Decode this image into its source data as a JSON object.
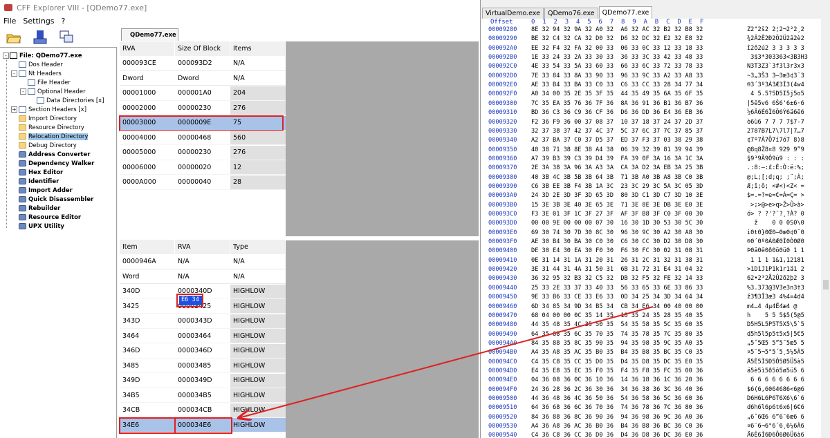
{
  "cff": {
    "title": "CFF Explorer VIII - [QDemo77.exe]",
    "menu": [
      "File",
      "Settings",
      "?"
    ],
    "active_tab": "QDemo77.exe",
    "tree": [
      {
        "label": "File: QDemo77.exe",
        "level": 0,
        "icon": "pe",
        "bold": true
      },
      {
        "label": "Dos Header",
        "level": 1,
        "icon": "doc"
      },
      {
        "label": "Nt Headers",
        "level": 1,
        "icon": "doc"
      },
      {
        "label": "File Header",
        "level": 2,
        "icon": "doc"
      },
      {
        "label": "Optional Header",
        "level": 2,
        "icon": "doc"
      },
      {
        "label": "Data Directories [x]",
        "level": 3,
        "icon": "doc"
      },
      {
        "label": "Section Headers [x]",
        "level": 1,
        "icon": "doc"
      },
      {
        "label": "Import Directory",
        "level": 1,
        "icon": "folder"
      },
      {
        "label": "Resource Directory",
        "level": 1,
        "icon": "folder"
      },
      {
        "label": "Relocation Directory",
        "level": 1,
        "icon": "folder",
        "selected": true
      },
      {
        "label": "Debug Directory",
        "level": 1,
        "icon": "folder"
      },
      {
        "label": "Address Converter",
        "level": 1,
        "icon": "tool",
        "bold": true
      },
      {
        "label": "Dependency Walker",
        "level": 1,
        "icon": "tool",
        "bold": true
      },
      {
        "label": "Hex Editor",
        "level": 1,
        "icon": "tool",
        "bold": true
      },
      {
        "label": "Identifier",
        "level": 1,
        "icon": "tool",
        "bold": true
      },
      {
        "label": "Import Adder",
        "level": 1,
        "icon": "tool",
        "bold": true
      },
      {
        "label": "Quick Disassembler",
        "level": 1,
        "icon": "tool",
        "bold": true
      },
      {
        "label": "Rebuilder",
        "level": 1,
        "icon": "tool",
        "bold": true
      },
      {
        "label": "Resource Editor",
        "level": 1,
        "icon": "tool",
        "bold": true
      },
      {
        "label": "UPX Utility",
        "level": 1,
        "icon": "tool",
        "bold": true
      }
    ],
    "top_table": {
      "headers": [
        "RVA",
        "Size Of Block",
        "Items"
      ],
      "first_row": [
        "000093CE",
        "000093D2",
        "N/A"
      ],
      "subheaders": [
        "Dword",
        "Dword",
        "N/A"
      ],
      "rows": [
        [
          "00001000",
          "000001A0",
          "204"
        ],
        [
          "00002000",
          "00000230",
          "276"
        ],
        [
          "00003000",
          "0000009E",
          "75"
        ],
        [
          "00004000",
          "00000468",
          "560"
        ],
        [
          "00005000",
          "00000230",
          "276"
        ],
        [
          "00006000",
          "00000020",
          "12"
        ],
        [
          "0000A000",
          "00000040",
          "28"
        ]
      ],
      "selected_row": 2
    },
    "bottom_table": {
      "headers": [
        "Item",
        "RVA",
        "Type"
      ],
      "first_row": [
        "0000946A",
        "N/A",
        "N/A"
      ],
      "subheaders": [
        "Word",
        "N/A",
        "N/A"
      ],
      "rows": [
        [
          "340D",
          "0000340D",
          "HIGHLOW"
        ],
        [
          "3425",
          "00003425",
          "HIGHLOW"
        ],
        [
          "343D",
          "0000343D",
          "HIGHLOW"
        ],
        [
          "3464",
          "00003464",
          "HIGHLOW"
        ],
        [
          "346D",
          "0000346D",
          "HIGHLOW"
        ],
        [
          "3485",
          "00003485",
          "HIGHLOW"
        ],
        [
          "349D",
          "0000349D",
          "HIGHLOW"
        ],
        [
          "34B5",
          "000034B5",
          "HIGHLOW"
        ],
        [
          "34CB",
          "000034CB",
          "HIGHLOW"
        ],
        [
          "34E6",
          "000034E6",
          "HIGHLOW"
        ]
      ],
      "selected_row": 9
    }
  },
  "hex": {
    "tabs": [
      "VirtualDemo.exe",
      "QDemo76.exe",
      "QDemo77.exe"
    ],
    "active_tab": 2,
    "header_offset": "Offset",
    "header_cols": "0  1  2  3  4  5  6  7  8  9  A  B  C  D  E  F",
    "selected_bytes": "E6 34",
    "rows": [
      {
        "o": "00009280",
        "b": "8E 32 94 32 9A 32 A0 32  A6 32 AC 32 B2 32 B8 32",
        "a": "Ž2\"2š2 2¦2¬2²2¸2"
      },
      {
        "o": "00009290",
        "b": "BE 32 C4 32 CA 32 D0 32  D6 32 DC 32 E2 32 E8 32",
        "a": "¾2Ä2Ê2Ð2Ö2Ü2â2è2"
      },
      {
        "o": "000092A0",
        "b": "EE 32 F4 32 FA 32 00 33  06 33 0C 33 12 33 18 33",
        "a": "î2ô2ú2 3 3 3 3 3"
      },
      {
        "o": "000092B0",
        "b": "1E 33 24 33 2A 33 30 33  36 33 3C 33 42 33 48 33",
        "a": " 3$3*303363<3B3H3"
      },
      {
        "o": "000092C0",
        "b": "4E 33 54 33 5A 33 60 33  66 33 6C 33 72 33 78 33",
        "a": "N3T3Z3`3f3l3r3x3"
      },
      {
        "o": "000092D0",
        "b": "7E 33 84 33 8A 33 90 33  96 33 9C 33 A2 33 A8 33",
        "a": "~3„3Š3 3–3œ3¢3¨3"
      },
      {
        "o": "000092E0",
        "b": "AE 33 B4 33 BA 33 C0 33  C6 33 CC 33 28 34 77 34",
        "a": "®3´3º3À3Æ3Ì3(4w4"
      },
      {
        "o": "000092F0",
        "b": "A0 34 00 35 2E 35 3F 35  44 35 49 35 6A 35 6F 35",
        "a": " 4 5.5?5D5I5j5o5"
      },
      {
        "o": "00009300",
        "b": "7C 35 EA 35 76 36 7F 36  8A 36 91 36 B1 36 B7 36",
        "a": "|5ê5v6 6Š6'6±6·6"
      },
      {
        "o": "00009310",
        "b": "BD 36 C3 36 C9 36 CF 36  D6 36 DD 36 E4 36 EB 36",
        "a": "½6Ã6É6Ï6Ö6Ý6ä6ë6"
      },
      {
        "o": "00009320",
        "b": "F2 36 F9 36 00 37 08 37  10 37 18 37 24 37 2D 37",
        "a": "ò6ù6 7 7 7 7$7-7"
      },
      {
        "o": "00009330",
        "b": "32 37 38 37 42 37 4C 37  5C 37 6C 37 7C 37 85 37",
        "a": "2787B7L7\\7l7|7…7"
      },
      {
        "o": "00009340",
        "b": "A2 37 BA 37 C0 37 D5 37  ED 37 F3 37 03 38 29 38",
        "a": "¢7º7À7Õ7í7ó7 8)8"
      },
      {
        "o": "00009350",
        "b": "40 38 71 38 8E 38 A4 38  06 39 32 39 81 39 94 39",
        "a": "@8q8Ž8¤8 929 9”9"
      },
      {
        "o": "00009360",
        "b": "A7 39 B3 39 C3 39 D4 39  FA 39 0F 3A 16 3A 1C 3A",
        "a": "§9³9Ã9Ô9ú9 : : :"
      },
      {
        "o": "00009370",
        "b": "2E 3A 38 3A 96 3A A3 3A  CA 3A D2 3A EB 3A 25 3B",
        "a": ".:8:–:£:Ê:Ò:ë:%;"
      },
      {
        "o": "00009380",
        "b": "40 3B 4C 3B 5B 3B 64 3B  71 3B A0 3B A8 3B C0 3B",
        "a": "@;L;[;d;q; ;¨;À;"
      },
      {
        "o": "00009390",
        "b": "C6 3B EE 3B F4 3B 1A 3C  23 3C 29 3C 5A 3C 05 3D",
        "a": "Æ;î;ô; <#<)<Z< ="
      },
      {
        "o": "000093A0",
        "b": "24 3D 2E 3D 3F 3D 65 3D  80 3D C1 3D C7 3D 10 3E",
        "a": "$=.=?=e=€=Á=Ç= >"
      },
      {
        "o": "000093B0",
        "b": "15 3E 3B 3E 40 3E 65 3E  71 3E 8E 3E DB 3E E0 3E",
        "a": " >;>@>e>q>Ž>Û>à>"
      },
      {
        "o": "000093C0",
        "b": "F3 3E 01 3F 1C 3F 27 3F  AF 3F B8 3F C0 3F 00 30",
        "a": "ó> ? ?'?¯?¸?À? 0"
      },
      {
        "o": "000093D0",
        "b": "00 00 9E 00 00 00 07 30  16 30 1D 30 53 30 5C 30",
        "a": "  ž    0 0 0S0\\0"
      },
      {
        "o": "000093E0",
        "b": "69 30 74 30 7D 30 8C 30  96 30 9C 30 A2 30 A8 30",
        "a": "i0t0}0Œ0–0œ0¢0¨0"
      },
      {
        "o": "000093F0",
        "b": "AE 30 B4 30 BA 30 C0 30  C6 30 CC 30 D2 30 D8 30",
        "a": "®0´0º0À0Æ0Ì0Ò0Ø0"
      },
      {
        "o": "00009400",
        "b": "DE 30 E4 30 EA 30 F0 30  F6 30 FC 30 02 31 08 31",
        "a": "Þ0ä0ê0ð0ö0ü0 1 1"
      },
      {
        "o": "00009410",
        "b": "0E 31 14 31 1A 31 20 31  26 31 2C 31 32 31 38 31",
        "a": " 1 1 1 1&1,12181"
      },
      {
        "o": "00009420",
        "b": "3E 31 44 31 4A 31 50 31  6B 31 72 31 E4 31 04 32",
        "a": ">1D1J1P1k1r1ä1 2"
      },
      {
        "o": "00009430",
        "b": "36 32 95 32 B3 32 C5 32  DB 32 F5 32 FE 32 14 33",
        "a": "62•2³2Å2Û2õ2þ2 3"
      },
      {
        "o": "00009440",
        "b": "25 33 2E 33 37 33 40 33  56 33 65 33 6E 33 86 33",
        "a": "%3.373@3V3e3n3†3"
      },
      {
        "o": "00009450",
        "b": "9E 33 B6 33 CE 33 E6 33  0D 34 25 34 3D 34 64 34",
        "a": "ž3¶3Î3æ3 4%4=4d4"
      },
      {
        "o": "00009460",
        "b": "6D 34 85 34 9D 34 B5 34  CB 34 E6 34 00 40 00 00",
        "a": "m4…4 4µ4Ë4æ4 @  "
      },
      {
        "o": "00009470",
        "b": "68 04 00 00 0C 35 14 35  18 35 24 35 28 35 40 35",
        "a": "h    5 5 5$5(5@5"
      },
      {
        "o": "00009480",
        "b": "44 35 48 35 4C 35 50 35  54 35 58 35 5C 35 60 35",
        "a": "D5H5L5P5T5X5\\5`5"
      },
      {
        "o": "00009490",
        "b": "64 35 68 35 6C 35 70 35  74 35 78 35 7C 35 80 35",
        "a": "d5h5l5p5t5x5|5€5"
      },
      {
        "o": "000094A0",
        "b": "84 35 88 35 8C 35 90 35  94 35 98 35 9C 35 A0 35",
        "a": "„5ˆ5Œ5 5”5˜5œ5 5"
      },
      {
        "o": "000094B0",
        "b": "A4 35 A8 35 AC 35 B0 35  B4 35 B8 35 BC 35 C0 35",
        "a": "¤5¨5¬5°5´5¸5¼5À5"
      },
      {
        "o": "000094C0",
        "b": "C4 35 C8 35 CC 35 D0 35  D4 35 D8 35 DC 35 E0 35",
        "a": "Ä5È5Ì5Ð5Ô5Ø5Ü5à5"
      },
      {
        "o": "000094D0",
        "b": "E4 35 E8 35 EC 35 F0 35  F4 35 F8 35 FC 35 00 36",
        "a": "ä5è5ì5ð5ô5ø5ü5 6"
      },
      {
        "o": "000094E0",
        "b": "04 36 08 36 0C 36 10 36  14 36 18 36 1C 36 20 36",
        "a": " 6 6 6 6 6 6 6 6"
      },
      {
        "o": "000094F0",
        "b": "24 36 28 36 2C 36 30 36  34 36 38 36 3C 36 40 36",
        "a": "$6(6,6064686<6@6"
      },
      {
        "o": "00009500",
        "b": "44 36 48 36 4C 36 50 36  54 36 58 36 5C 36 60 36",
        "a": "D6H6L6P6T6X6\\6`6"
      },
      {
        "o": "00009510",
        "b": "64 36 68 36 6C 36 70 36  74 36 78 36 7C 36 80 36",
        "a": "d6h6l6p6t6x6|6€6"
      },
      {
        "o": "00009520",
        "b": "84 36 88 36 8C 36 90 36  94 36 98 36 9C 36 A0 36",
        "a": "„6ˆ6Œ6 6”6˜6œ6 6"
      },
      {
        "o": "00009530",
        "b": "A4 36 A8 36 AC 36 B0 36  B4 36 B8 36 BC 36 C0 36",
        "a": "¤6¨6¬6°6´6¸6¼6À6"
      },
      {
        "o": "00009540",
        "b": "C4 36 C8 36 CC 36 D0 36  D4 36 D8 36 DC 36 E0 36",
        "a": "Ä6È6Ì6Ð6Ô6Ø6Ü6à6"
      },
      {
        "o": "00009550",
        "b": "E4 36 E8 36 EC 36 F0 36  F4 36 F8 36 FC 36 00 37",
        "a": "ä6è6ì6ð6ô6ø6ü6 7"
      }
    ]
  },
  "colors": {
    "selection": "#a8c2e8",
    "annotation": "#e02020",
    "hex_offset": "#1a38c0"
  }
}
